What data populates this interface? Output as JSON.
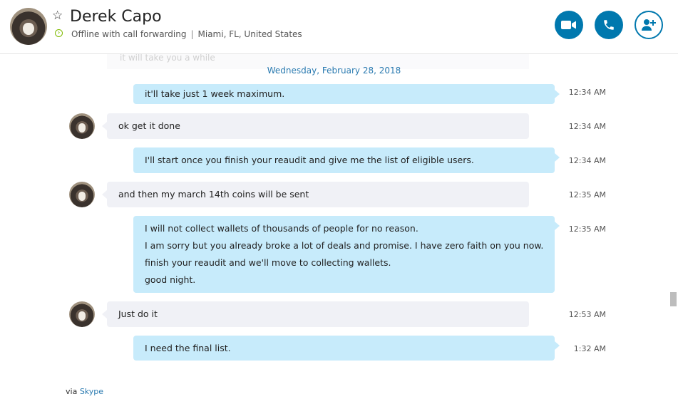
{
  "header": {
    "contact_name": "Derek Capo",
    "status": "Offline with call forwarding",
    "separator": "|",
    "location": "Miami, FL, United States",
    "buttons": [
      {
        "name": "video-call-button",
        "icon": "video-camera-icon"
      },
      {
        "name": "audio-call-button",
        "icon": "phone-icon"
      },
      {
        "name": "add-people-button",
        "icon": "add-person-icon"
      }
    ]
  },
  "chat": {
    "faded_preview": "it will take you a while",
    "date_separator": "Wednesday, February 28, 2018",
    "messages": [
      {
        "direction": "out",
        "lines": [
          "it'll take just 1 week maximum."
        ],
        "time": "12:34 AM"
      },
      {
        "direction": "in",
        "lines": [
          "ok get it done"
        ],
        "time": "12:34 AM"
      },
      {
        "direction": "out",
        "lines": [
          "I'll start once you finish your reaudit and give me the list of eligible users."
        ],
        "time": "12:34 AM"
      },
      {
        "direction": "in",
        "lines": [
          "and then my march 14th coins will be sent"
        ],
        "time": "12:35 AM"
      },
      {
        "direction": "out",
        "lines": [
          "I will not collect wallets of thousands of people for no reason.",
          "I am sorry but you already broke a lot of deals and promise. I have zero faith on you now.",
          "finish your reaudit and we'll move to collecting wallets.",
          "good night."
        ],
        "time": "12:35 AM"
      },
      {
        "direction": "in",
        "lines": [
          "Just do it"
        ],
        "time": "12:53 AM"
      },
      {
        "direction": "out",
        "lines": [
          "I need the final list."
        ],
        "time": "1:32 AM"
      }
    ]
  },
  "footer": {
    "via": "via",
    "service": "Skype"
  },
  "colors": {
    "accent": "#0078ae",
    "outgoing_bubble": "#c7ebfb",
    "incoming_bubble": "#f0f1f6",
    "date_text": "#2a7ab0",
    "status_green": "#7fba00"
  }
}
